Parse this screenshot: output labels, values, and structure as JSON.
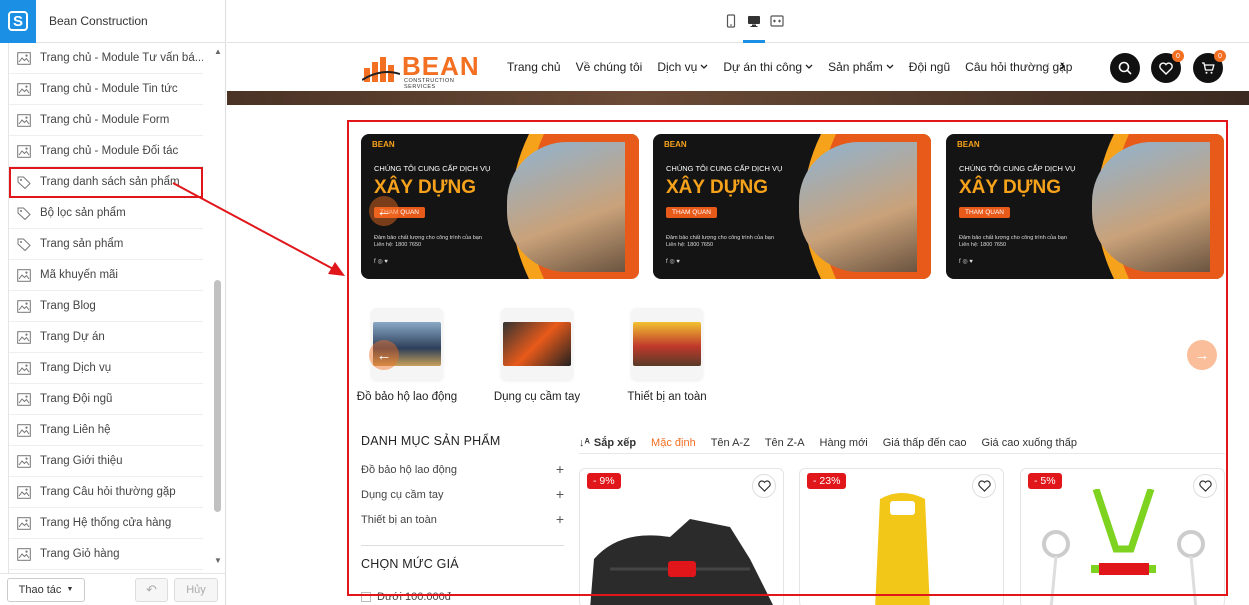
{
  "app": {
    "title": "Bean Construction",
    "logo_letter": "S"
  },
  "sidebar": {
    "items": [
      {
        "label": "Trang chủ - Module Tư vấn bá...",
        "icon": "image-icon"
      },
      {
        "label": "Trang chủ - Module Tin tức",
        "icon": "image-icon"
      },
      {
        "label": "Trang chủ - Module Form",
        "icon": "image-icon"
      },
      {
        "label": "Trang chủ - Module Đối tác",
        "icon": "image-icon"
      },
      {
        "label": "Trang danh sách sản phẩm",
        "icon": "tag-icon"
      },
      {
        "label": "Bộ lọc sản phẩm",
        "icon": "tag-icon"
      },
      {
        "label": "Trang sản phẩm",
        "icon": "tag-icon"
      },
      {
        "label": "Mã khuyến mãi",
        "icon": "image-icon"
      },
      {
        "label": "Trang Blog",
        "icon": "image-icon"
      },
      {
        "label": "Trang Dự án",
        "icon": "image-icon"
      },
      {
        "label": "Trang Dịch vụ",
        "icon": "image-icon"
      },
      {
        "label": "Trang Đội ngũ",
        "icon": "image-icon"
      },
      {
        "label": "Trang Liên hệ",
        "icon": "image-icon"
      },
      {
        "label": "Trang Giới thiệu",
        "icon": "image-icon"
      },
      {
        "label": "Trang Câu hỏi thường gặp",
        "icon": "image-icon"
      },
      {
        "label": "Trang Hệ thống cửa hàng",
        "icon": "image-icon"
      },
      {
        "label": "Trang Giỏ hàng",
        "icon": "image-icon"
      }
    ],
    "highlighted_index": 4,
    "footer": {
      "action_label": "Thao tác",
      "undo_icon": "undo-icon",
      "cancel_label": "Hủy"
    }
  },
  "devices": [
    "mobile-icon",
    "desktop-icon",
    "fullwidth-icon"
  ],
  "site": {
    "brand": {
      "name": "BEAN",
      "sub": "CONSTRUCTION SERVICES"
    },
    "nav": [
      {
        "label": "Trang chủ",
        "dropdown": false
      },
      {
        "label": "Về chúng tôi",
        "dropdown": false
      },
      {
        "label": "Dịch vụ",
        "dropdown": true
      },
      {
        "label": "Dự án thi công",
        "dropdown": true
      },
      {
        "label": "Sản phẩm",
        "dropdown": true
      },
      {
        "label": "Đội ngũ",
        "dropdown": false
      },
      {
        "label": "Câu hỏi thường gặp",
        "dropdown": false
      }
    ],
    "wishlist_count": "0",
    "cart_count": "0",
    "banner": {
      "brand": "BEAN",
      "line1": "CHÚNG TÔI CUNG CẤP DỊCH VỤ",
      "line2": "XÂY DỰNG",
      "cta": "THAM QUAN",
      "desc": "Đảm bảo chất lượng cho công trình của bạn",
      "hotline": "Liên hệ: 1800 7650",
      "social": "f ◎ ♥"
    },
    "categories": [
      "Đồ bảo hộ lao động",
      "Dụng cụ cầm tay",
      "Thiết bị an toàn"
    ],
    "filter": {
      "title": "DANH MỤC SẢN PHẨM",
      "items": [
        "Đồ bảo hộ lao động",
        "Dụng cụ cầm tay",
        "Thiết bị an toàn"
      ],
      "price_title": "CHỌN MỨC GIÁ",
      "price_first": "Dưới 100.000đ"
    },
    "sort": {
      "label": "Sắp xếp",
      "options": [
        "Mặc định",
        "Tên A-Z",
        "Tên Z-A",
        "Hàng mới",
        "Giá thấp đến cao",
        "Giá cao xuống thấp"
      ],
      "active_index": 0
    },
    "products": [
      {
        "discount": "- 9%"
      },
      {
        "discount": "- 23%"
      },
      {
        "discount": "- 5%"
      }
    ]
  },
  "colors": {
    "accent": "#f36f21",
    "highlight": "#e0161b",
    "app_blue": "#1a8fe3"
  }
}
